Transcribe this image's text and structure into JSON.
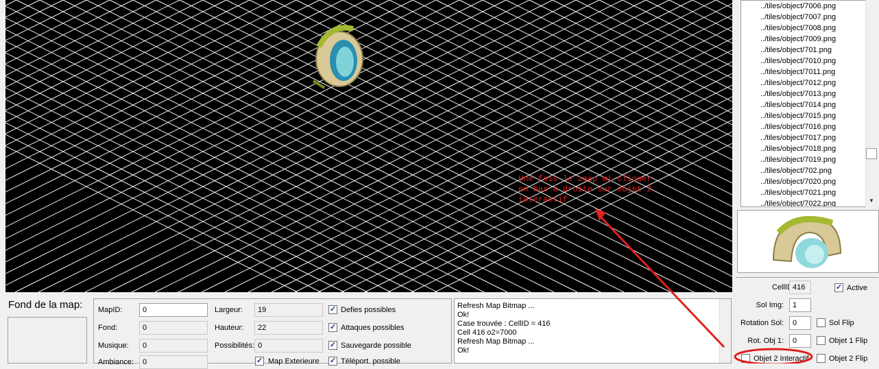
{
  "tile_list": {
    "items": [
      "../tiles/object/7006.png",
      "../tiles/object/7007.png",
      "../tiles/object/7008.png",
      "../tiles/object/7009.png",
      "../tiles/object/701.png",
      "../tiles/object/7010.png",
      "../tiles/object/7011.png",
      "../tiles/object/7012.png",
      "../tiles/object/7013.png",
      "../tiles/object/7014.png",
      "../tiles/object/7015.png",
      "../tiles/object/7016.png",
      "../tiles/object/7017.png",
      "../tiles/object/7018.png",
      "../tiles/object/7019.png",
      "../tiles/object/702.png",
      "../tiles/object/7020.png",
      "../tiles/object/7021.png",
      "../tiles/object/7022.png"
    ]
  },
  "cell_props": {
    "cellid_label": "CellID:",
    "cellid_value": "416",
    "active_label": "Active",
    "active_checked": true,
    "sol_img_label": "Sol Img:",
    "sol_img_value": "1",
    "rotation_sol_label": "Rotation Sol:",
    "rotation_sol_value": "0",
    "sol_flip_label": "Sol Flip",
    "rot_obj1_label": "Rot. Obj 1:",
    "rot_obj1_value": "0",
    "objet1_flip_label": "Objet 1 Flip",
    "objet2_interactif_label": "Objet 2 Interactif",
    "objet2_flip_label": "Objet 2 Flip"
  },
  "fond": {
    "title": "Fond de la map:"
  },
  "map_props": {
    "mapid_label": "MapID:",
    "mapid_value": "0",
    "fond_label": "Fond:",
    "fond_value": "0",
    "musique_label": "Musique:",
    "musique_value": "0",
    "ambiance_label": "Ambiance:",
    "ambiance_value": "0",
    "largeur_label": "Largeur:",
    "largeur_value": "19",
    "hauteur_label": "Hauteur:",
    "hauteur_value": "22",
    "possibilites_label": "Possibilités:",
    "possibilites_value": "0",
    "map_exterieure_label": "Map Exterieure",
    "defies_label": "Defies possibles",
    "attaques_label": "Attaques possibles",
    "sauvegarde_label": "Sauvegarde possible",
    "teleport_label": "Téléport. possible"
  },
  "log": {
    "lines": [
      "Refresh Map Bitmap ...",
      "Ok!",
      "Case trouvée :  CellID = 416",
      "Cell 416 o2=7000",
      "Refresh Map Bitmap ...",
      "Ok!"
    ]
  },
  "annotation": {
    "text": "Une fois le zaap mi cliquer en bas a droite sur objet 2 interactif",
    "color": "#e0201e"
  },
  "colors": {
    "map_bg": "#000000",
    "grid": "#ffffff",
    "panel_bg": "#f0f0f0"
  }
}
